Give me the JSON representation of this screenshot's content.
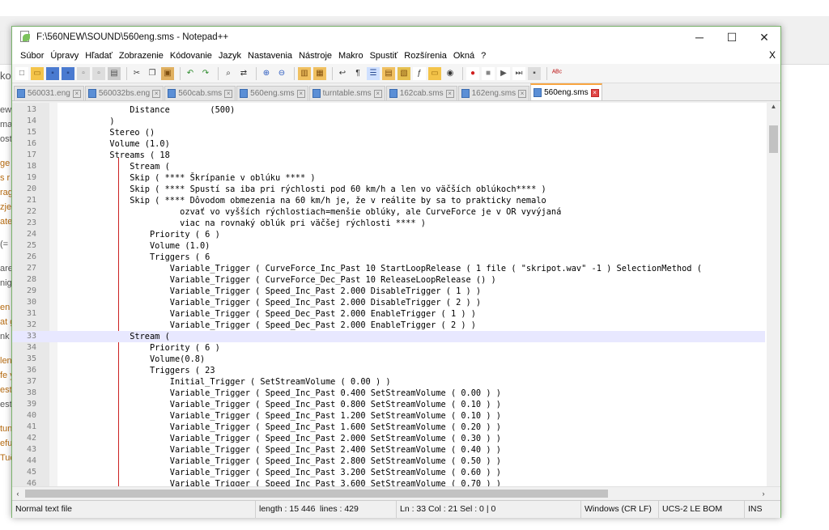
{
  "window": {
    "title": "F:\\560NEW\\SOUND\\560eng.sms - Notepad++",
    "minimize": "─",
    "maximize": "☐",
    "close": "✕"
  },
  "background_fragments": [
    "ko",
    "ew",
    "ma",
    "ost",
    "ge",
    "s r",
    "rag",
    "zje",
    "ate",
    "(=",
    "are",
    "nig",
    "en",
    "at g",
    "nk",
    "len",
    "fe y",
    "est",
    "est",
    "tun",
    "efu",
    "Tuč"
  ],
  "menu": {
    "items": [
      "Súbor",
      "Úpravy",
      "Hľadať",
      "Zobrazenie",
      "Kódovanie",
      "Jazyk",
      "Nastavenia",
      "Nástroje",
      "Makro",
      "Spustiť",
      "Rozšírenia",
      "Okná",
      "?"
    ],
    "close": "X"
  },
  "tabs": [
    {
      "label": "560031.eng",
      "active": false
    },
    {
      "label": "560032bs.eng",
      "active": false
    },
    {
      "label": "560cab.sms",
      "active": false
    },
    {
      "label": "560eng.sms",
      "active": false
    },
    {
      "label": "turntable.sms",
      "active": false
    },
    {
      "label": "162cab.sms",
      "active": false
    },
    {
      "label": "162eng.sms",
      "active": false
    },
    {
      "label": "560eng.sms",
      "active": true
    }
  ],
  "editor": {
    "current_line": 33,
    "lines": [
      {
        "n": "13",
        "t": "                Distance        (500)"
      },
      {
        "n": "14",
        "t": "            )"
      },
      {
        "n": "15",
        "t": "            Stereo ()"
      },
      {
        "n": "16",
        "t": "            Volume (1.0)"
      },
      {
        "n": "17",
        "t": "            Streams ( 18"
      },
      {
        "n": "18",
        "t": "                Stream ("
      },
      {
        "n": "19",
        "t": "                Skip ( **** Škrípanie v oblúku **** )"
      },
      {
        "n": "20",
        "t": "                Skip ( **** Spustí sa iba pri rýchlosti pod 60 km/h a len vo väčších oblúkoch**** )"
      },
      {
        "n": "21",
        "t": "                Skip ( **** Dôvodom obmezenia na 60 km/h je, že v reálite by sa to prakticky nemalo"
      },
      {
        "n": "22",
        "t": "                          ozvať vo vyšších rýchlostiach=menšie oblúky, ale CurveForce je v OR vyvýjaná"
      },
      {
        "n": "23",
        "t": "                          viac na rovnaký oblúk pri väčšej rýchlosti **** )"
      },
      {
        "n": "24",
        "t": "                    Priority ( 6 )"
      },
      {
        "n": "25",
        "t": "                    Volume (1.0)"
      },
      {
        "n": "26",
        "t": "                    Triggers ( 6"
      },
      {
        "n": "27",
        "t": "                        Variable_Trigger ( CurveForce_Inc_Past 10 StartLoopRelease ( 1 file ( \"skripot.wav\" -1 ) SelectionMethod ("
      },
      {
        "n": "28",
        "t": "                        Variable_Trigger ( CurveForce_Dec_Past 10 ReleaseLoopRelease () )"
      },
      {
        "n": "29",
        "t": "                        Variable_Trigger ( Speed_Inc_Past 2.000 DisableTrigger ( 1 ) )"
      },
      {
        "n": "30",
        "t": "                        Variable_Trigger ( Speed_Inc_Past 2.000 DisableTrigger ( 2 ) )"
      },
      {
        "n": "31",
        "t": "                        Variable_Trigger ( Speed_Dec_Past 2.000 EnableTrigger ( 1 ) )"
      },
      {
        "n": "32",
        "t": "                        Variable_Trigger ( Speed_Dec_Past 2.000 EnableTrigger ( 2 ) )"
      },
      {
        "n": "33",
        "t": "                Stream ("
      },
      {
        "n": "34",
        "t": "                    Priority ( 6 )"
      },
      {
        "n": "35",
        "t": "                    Volume(0.8)"
      },
      {
        "n": "36",
        "t": "                    Triggers ( 23"
      },
      {
        "n": "37",
        "t": "                        Initial_Trigger ( SetStreamVolume ( 0.00 ) )"
      },
      {
        "n": "38",
        "t": "                        Variable_Trigger ( Speed_Inc_Past 0.400 SetStreamVolume ( 0.00 ) )"
      },
      {
        "n": "39",
        "t": "                        Variable_Trigger ( Speed_Inc_Past 0.800 SetStreamVolume ( 0.10 ) )"
      },
      {
        "n": "40",
        "t": "                        Variable_Trigger ( Speed_Inc_Past 1.200 SetStreamVolume ( 0.10 ) )"
      },
      {
        "n": "41",
        "t": "                        Variable_Trigger ( Speed_Inc_Past 1.600 SetStreamVolume ( 0.20 ) )"
      },
      {
        "n": "42",
        "t": "                        Variable_Trigger ( Speed_Inc_Past 2.000 SetStreamVolume ( 0.30 ) )"
      },
      {
        "n": "43",
        "t": "                        Variable_Trigger ( Speed_Inc_Past 2.400 SetStreamVolume ( 0.40 ) )"
      },
      {
        "n": "44",
        "t": "                        Variable_Trigger ( Speed_Inc_Past 2.800 SetStreamVolume ( 0.50 ) )"
      },
      {
        "n": "45",
        "t": "                        Variable_Trigger ( Speed_Inc_Past 3.200 SetStreamVolume ( 0.60 ) )"
      },
      {
        "n": "46",
        "t": "                        Variable_Trigger ( Speed_Inc_Past 3.600 SetStreamVolume ( 0.70 ) )"
      }
    ]
  },
  "status": {
    "file_type": "Normal text file",
    "length": "length : 15 446",
    "lines": "lines : 429",
    "position": "Ln : 33    Col : 21    Sel : 0 | 0",
    "eol": "Windows (CR LF)",
    "encoding": "UCS-2 LE BOM",
    "mode": "INS"
  },
  "icons": {
    "toolbar": [
      "new-file-icon",
      "open-file-icon",
      "save-icon",
      "save-all-icon",
      "close-icon",
      "close-all-icon",
      "print-icon",
      "cut-icon",
      "copy-icon",
      "paste-icon",
      "undo-icon",
      "redo-icon",
      "find-icon",
      "replace-icon",
      "zoom-in-icon",
      "zoom-out-icon",
      "sync-v-icon",
      "sync-h-icon",
      "word-wrap-icon",
      "all-chars-icon",
      "indent-guide-icon",
      "udl-icon",
      "doc-map-icon",
      "function-list-icon",
      "folder-workspace-icon",
      "monitor-icon",
      "record-macro-icon",
      "stop-record-icon",
      "play-macro-icon",
      "run-macro-multiple-icon",
      "save-macro-icon",
      "spell-check-icon"
    ]
  },
  "colors": {
    "window_border": "#7bb36d",
    "active_tab_accent": "#f8a540",
    "current_line": "#e8e8ff",
    "fold_line": "#cc2222"
  }
}
